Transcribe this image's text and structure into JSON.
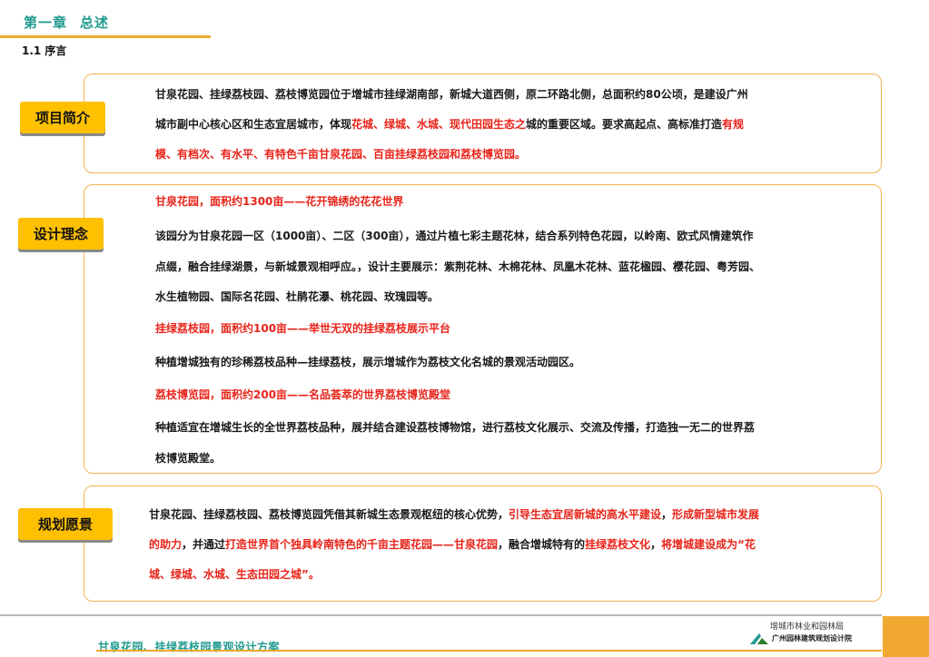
{
  "header": {
    "chapter_num": "第一章",
    "chapter_name": "总述",
    "section": "1.1 序言"
  },
  "intro": {
    "tag": "项目简介",
    "lines": [
      [
        {
          "t": "甘泉花园、挂绿荔枝园、荔枝博览园位于增城市挂绿湖南部，新城大道西侧，原二环路北侧，总面积约80公顷，是建设广州",
          "red": false
        }
      ],
      [
        {
          "t": "城市副中心核心区和生态宜居城市，体现",
          "red": false
        },
        {
          "t": "花城、绿城、水城、现代田园生态之",
          "red": true
        },
        {
          "t": "城的重要区域。要求高起点、高标准打造",
          "red": false
        },
        {
          "t": "有规",
          "red": true
        }
      ],
      [
        {
          "t": "模、有档次、有水平、有特色千亩甘泉花园、百亩挂绿荔枝园和荔枝博览园。",
          "red": true
        }
      ]
    ]
  },
  "concept": {
    "tag": "设计理念",
    "h1": "甘泉花园，面积约1300亩——花开锦绣的花花世界",
    "p1": [
      "该园分为甘泉花园一区（1000亩）、二区（300亩），通过片植七彩主题花林，结合系列特色花园，以岭南、欧式风情建筑作",
      "点缀，融合挂绿湖景，与新城景观相呼应。，设计主要展示：紫荆花林、木棉花林、凤凰木花林、蓝花楹园、樱花园、粤芳园、",
      "水生植物园、国际名花园、杜鹃花瀑、桃花园、玫瑰园等。"
    ],
    "h2": "挂绿荔枝园，面积约100亩——举世无双的挂绿荔枝展示平台",
    "p2": "种植增城独有的珍稀荔枝品种—挂绿荔枝，展示增城作为荔枝文化名城的景观活动园区。",
    "h3": "荔枝博览园，面积约200亩——名品荟萃的世界荔枝博览殿堂",
    "p3": [
      "种植适宜在增城生长的全世界荔枝品种，展并结合建设荔枝博物馆，进行荔枝文化展示、交流及传播，打造独一无二的世界荔",
      "枝博览殿堂。"
    ]
  },
  "vision": {
    "tag": "规划愿景",
    "lines": [
      [
        {
          "t": "甘泉花园、挂绿荔枝园、荔枝博览园凭借其新城生态景观枢纽的核心优势，",
          "red": false
        },
        {
          "t": "引导生态宜居新城的高水平建设",
          "red": true
        },
        {
          "t": "，",
          "red": false
        },
        {
          "t": "形成新型城市发展",
          "red": true
        }
      ],
      [
        {
          "t": "的助力",
          "red": true
        },
        {
          "t": "，并通过",
          "red": false
        },
        {
          "t": "打造世界首个独具岭南特色的千亩主题花园——甘泉花园",
          "red": true
        },
        {
          "t": "，融合增城特有的",
          "red": false
        },
        {
          "t": "挂绿荔枝文化",
          "red": true
        },
        {
          "t": "，",
          "red": false
        },
        {
          "t": "将增城建设成为“花",
          "red": true
        }
      ],
      [
        {
          "t": "城、绿城、水城、生态田园之城”。",
          "red": true
        }
      ]
    ]
  },
  "footer": {
    "project_title": "甘泉花园、挂绿荔枝园景观设计方案",
    "org1": "增城市林业和园林局",
    "org2": "广州园林建筑规划设计院"
  },
  "colors": {
    "accent_orange": "#f0a830",
    "tag_yellow": "#ffc000",
    "title_teal": "#1f9a8f",
    "highlight_red": "#e8241a"
  }
}
